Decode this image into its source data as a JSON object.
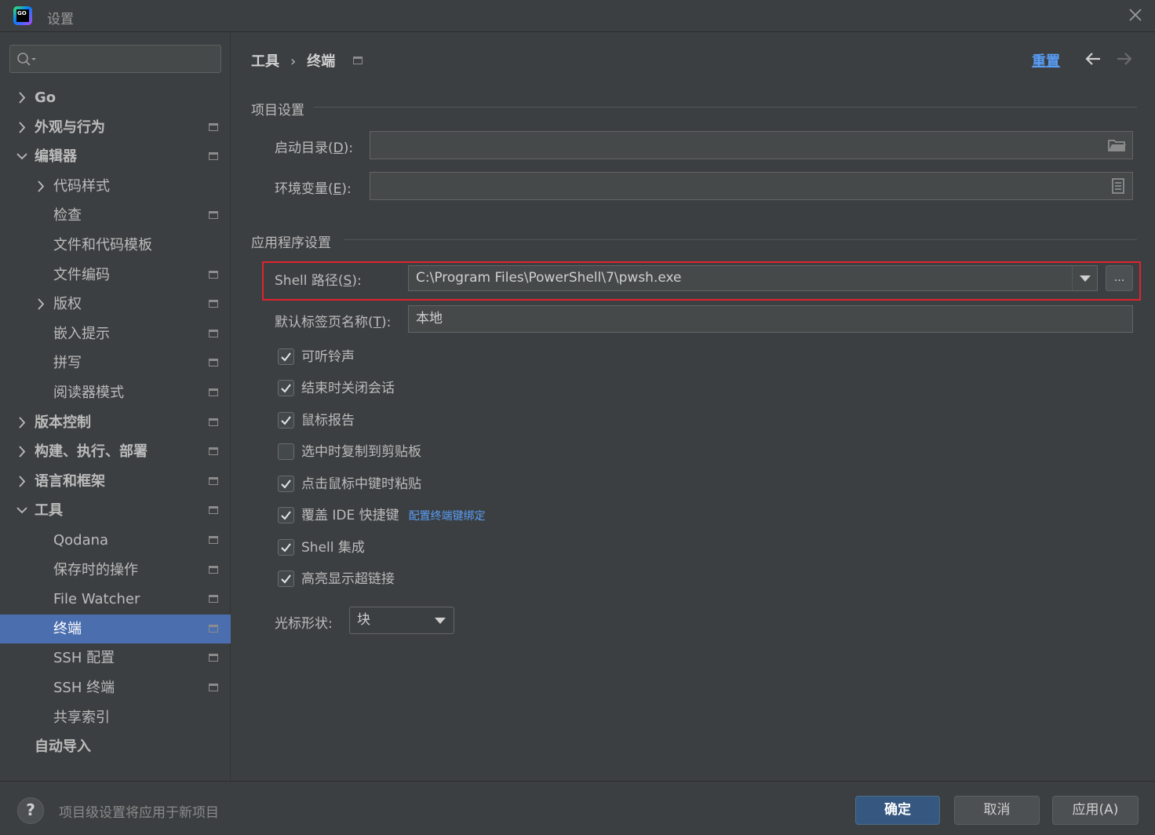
{
  "window": {
    "title": "设置",
    "logo_text": "GO"
  },
  "search": {
    "placeholder": "",
    "value": ""
  },
  "sidebar": {
    "items": [
      {
        "label": "Go",
        "level": 0,
        "arrow": "right",
        "bold": true,
        "project_icon": false
      },
      {
        "label": "外观与行为",
        "level": 0,
        "arrow": "right",
        "bold": true,
        "project_icon": true
      },
      {
        "label": "编辑器",
        "level": 0,
        "arrow": "down",
        "bold": true,
        "project_icon": true
      },
      {
        "label": "代码样式",
        "level": 1,
        "arrow": "right",
        "bold": false,
        "project_icon": false
      },
      {
        "label": "检查",
        "level": 1,
        "arrow": "",
        "bold": false,
        "project_icon": true
      },
      {
        "label": "文件和代码模板",
        "level": 1,
        "arrow": "",
        "bold": false,
        "project_icon": false
      },
      {
        "label": "文件编码",
        "level": 1,
        "arrow": "",
        "bold": false,
        "project_icon": true
      },
      {
        "label": "版权",
        "level": 1,
        "arrow": "right",
        "bold": false,
        "project_icon": true
      },
      {
        "label": "嵌入提示",
        "level": 1,
        "arrow": "",
        "bold": false,
        "project_icon": true
      },
      {
        "label": "拼写",
        "level": 1,
        "arrow": "",
        "bold": false,
        "project_icon": true
      },
      {
        "label": "阅读器模式",
        "level": 1,
        "arrow": "",
        "bold": false,
        "project_icon": true
      },
      {
        "label": "版本控制",
        "level": 0,
        "arrow": "right",
        "bold": true,
        "project_icon": true
      },
      {
        "label": "构建、执行、部署",
        "level": 0,
        "arrow": "right",
        "bold": true,
        "project_icon": true
      },
      {
        "label": "语言和框架",
        "level": 0,
        "arrow": "right",
        "bold": true,
        "project_icon": true
      },
      {
        "label": "工具",
        "level": 0,
        "arrow": "down",
        "bold": true,
        "project_icon": true
      },
      {
        "label": "Qodana",
        "level": 1,
        "arrow": "",
        "bold": false,
        "project_icon": true
      },
      {
        "label": "保存时的操作",
        "level": 1,
        "arrow": "",
        "bold": false,
        "project_icon": true
      },
      {
        "label": "File Watcher",
        "level": 1,
        "arrow": "",
        "bold": false,
        "project_icon": true
      },
      {
        "label": "终端",
        "level": 1,
        "arrow": "",
        "bold": false,
        "project_icon": true,
        "selected": true
      },
      {
        "label": "SSH 配置",
        "level": 1,
        "arrow": "",
        "bold": false,
        "project_icon": true
      },
      {
        "label": "SSH 终端",
        "level": 1,
        "arrow": "",
        "bold": false,
        "project_icon": true
      },
      {
        "label": "共享索引",
        "level": 1,
        "arrow": "",
        "bold": false,
        "project_icon": false
      },
      {
        "label": "自动导入",
        "level": 0,
        "arrow": "",
        "bold": true,
        "project_icon": false
      }
    ]
  },
  "breadcrumb": {
    "parent": "工具",
    "separator": "›",
    "current": "终端"
  },
  "header": {
    "reset_label": "重置"
  },
  "project_settings": {
    "title": "项目设置",
    "start_dir_label": "启动目录(",
    "start_dir_mnemonic": "D",
    "start_dir_suffix": "):",
    "start_dir_value": "",
    "env_label": "环境变量(",
    "env_mnemonic": "E",
    "env_suffix": "):",
    "env_value": ""
  },
  "app_settings": {
    "title": "应用程序设置",
    "shell_label": "Shell 路径(",
    "shell_mnemonic": "S",
    "shell_suffix": "):",
    "shell_value": "C:\\Program Files\\PowerShell\\7\\pwsh.exe",
    "browse_label": "...",
    "tab_name_label": "默认标签页名称(",
    "tab_name_mnemonic": "T",
    "tab_name_suffix": "):",
    "tab_name_value": "本地",
    "checkboxes": [
      {
        "label": "可听铃声",
        "checked": true
      },
      {
        "label": "结束时关闭会话",
        "checked": true
      },
      {
        "label": "鼠标报告",
        "checked": true
      },
      {
        "label": "选中时复制到剪贴板",
        "checked": false
      },
      {
        "label": "点击鼠标中键时粘贴",
        "checked": true
      },
      {
        "label": "覆盖 IDE 快捷键",
        "checked": true,
        "link": "配置终端键绑定"
      },
      {
        "label": "Shell 集成",
        "checked": true
      },
      {
        "label": "高亮显示超链接",
        "checked": true
      }
    ],
    "cursor_label": "光标形状:",
    "cursor_value": "块"
  },
  "footer": {
    "help_label": "?",
    "note": "项目级设置将应用于新项目",
    "ok_label": "确定",
    "cancel_label": "取消",
    "apply_label": "应用(A)"
  },
  "colors": {
    "background": "#3c3f41",
    "selection": "#4b6eaf",
    "link": "#589df6",
    "highlight_border": "#e0232f",
    "primary_button": "#365880"
  }
}
